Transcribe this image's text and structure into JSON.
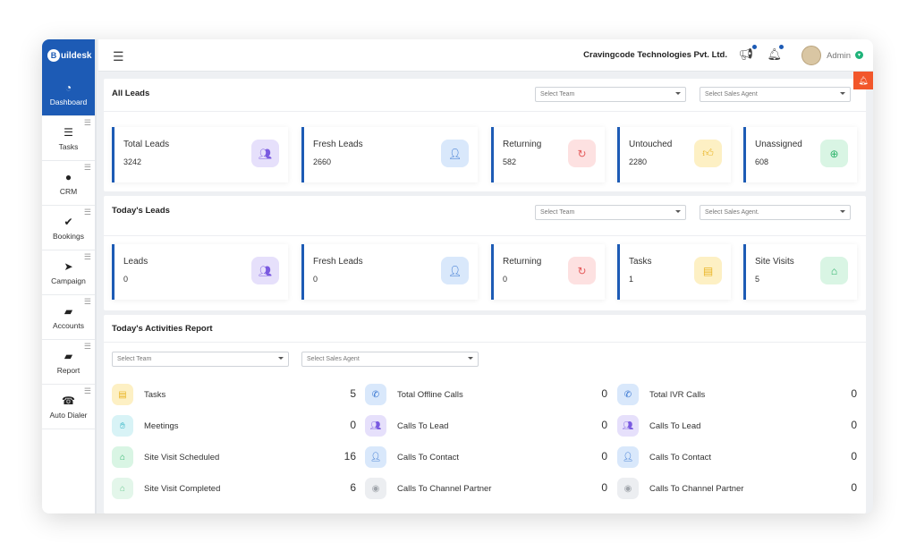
{
  "brand": {
    "name": "uildesk",
    "badge": "B"
  },
  "sidebar": {
    "items": [
      {
        "label": "Dashboard",
        "icon": "dashboard-icon",
        "glyph": "◔"
      },
      {
        "label": "Tasks",
        "icon": "tasks-icon",
        "glyph": "☰"
      },
      {
        "label": "CRM",
        "icon": "user-icon",
        "glyph": "●"
      },
      {
        "label": "Bookings",
        "icon": "bookings-icon",
        "glyph": "✔"
      },
      {
        "label": "Campaign",
        "icon": "send-icon",
        "glyph": "➤"
      },
      {
        "label": "Accounts",
        "icon": "folder-icon",
        "glyph": "▰"
      },
      {
        "label": "Report",
        "icon": "folder-open-icon",
        "glyph": "▰"
      },
      {
        "label": "Auto Dialer",
        "icon": "phone-icon",
        "glyph": "☎"
      }
    ]
  },
  "topbar": {
    "company": "Cravingcode Technologies Pvt. Ltd.",
    "user": "Admin"
  },
  "all_leads": {
    "title": "All Leads",
    "team_placeholder": "Select Team",
    "agent_placeholder": "Select Sales Agent",
    "stats": [
      {
        "label": "Total Leads",
        "value": "3242",
        "icon": "team-icon",
        "color": "purple"
      },
      {
        "label": "Fresh Leads",
        "value": "2660",
        "icon": "user-icon",
        "color": "blue"
      },
      {
        "label": "Returning",
        "value": "582",
        "icon": "refresh-icon",
        "color": "pink"
      },
      {
        "label": "Untouched",
        "value": "2280",
        "icon": "thumb-icon",
        "color": "yellow"
      },
      {
        "label": "Unassigned",
        "value": "608",
        "icon": "user-add-icon",
        "color": "green"
      }
    ]
  },
  "todays_leads": {
    "title": "Today's Leads",
    "team_placeholder": "Select Team",
    "agent_placeholder": "Select Sales Agent.",
    "stats": [
      {
        "label": "Leads",
        "value": "0",
        "icon": "team-icon",
        "color": "purple"
      },
      {
        "label": "Fresh Leads",
        "value": "0",
        "icon": "user-icon",
        "color": "blue"
      },
      {
        "label": "Returning",
        "value": "0",
        "icon": "refresh-icon",
        "color": "pink"
      },
      {
        "label": "Tasks",
        "value": "1",
        "icon": "note-icon",
        "color": "yellow"
      },
      {
        "label": "Site Visits",
        "value": "5",
        "icon": "home-icon",
        "color": "green"
      }
    ]
  },
  "activities": {
    "title": "Today's Activities Report",
    "team_placeholder": "Select Team",
    "agent_placeholder": "Select Sales Agent",
    "columns": [
      [
        {
          "label": "Tasks",
          "value": "5",
          "icon": "note-icon",
          "color": "yellow"
        },
        {
          "label": "Meetings",
          "value": "0",
          "icon": "handshake-icon",
          "color": "cyan"
        },
        {
          "label": "Site Visit Scheduled",
          "value": "16",
          "icon": "home-icon",
          "color": "green"
        },
        {
          "label": "Site Visit Completed",
          "value": "6",
          "icon": "home-icon",
          "color": "lgreen"
        }
      ],
      [
        {
          "label": "Total Offline Calls",
          "value": "0",
          "icon": "phone-icon",
          "color": "blue"
        },
        {
          "label": "Calls To Lead",
          "value": "0",
          "icon": "team-icon",
          "color": "purple"
        },
        {
          "label": "Calls To Contact",
          "value": "0",
          "icon": "user-icon",
          "color": "blue"
        },
        {
          "label": "Calls To Channel Partner",
          "value": "0",
          "icon": "partner-icon",
          "color": "gray"
        }
      ],
      [
        {
          "label": "Total IVR Calls",
          "value": "0",
          "icon": "phone-icon",
          "color": "blue"
        },
        {
          "label": "Calls To Lead",
          "value": "0",
          "icon": "team-icon",
          "color": "purple"
        },
        {
          "label": "Calls To Contact",
          "value": "0",
          "icon": "user-icon",
          "color": "blue"
        },
        {
          "label": "Calls To Channel Partner",
          "value": "0",
          "icon": "partner-icon",
          "color": "gray"
        }
      ]
    ]
  },
  "colors": {
    "accent": "#1d5bb5",
    "alert": "#f2572b",
    "online": "#1fb37a"
  }
}
